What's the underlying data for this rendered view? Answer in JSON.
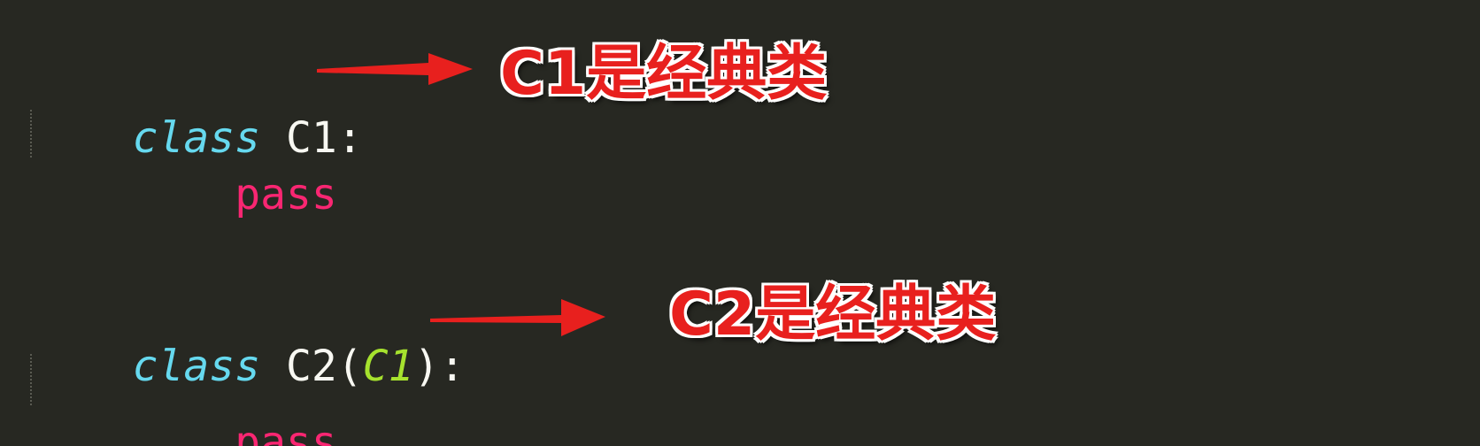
{
  "code": {
    "block1": {
      "keyword": "class",
      "class_name": "C1",
      "colon": ":",
      "body": "pass"
    },
    "block2": {
      "keyword": "class",
      "class_name": "C2",
      "open_paren": "(",
      "base_class": "C1",
      "close_paren_colon": "):",
      "body": "pass"
    }
  },
  "annotations": {
    "first": "C1是经典类",
    "second": "C2是经典类"
  },
  "colors": {
    "background": "#272822",
    "keyword": "#66d9ef",
    "pass_keyword": "#f92672",
    "base_class": "#a6e22e",
    "text": "#f8f8f2",
    "annotation": "#e8201e",
    "arrow": "#e8201e"
  }
}
